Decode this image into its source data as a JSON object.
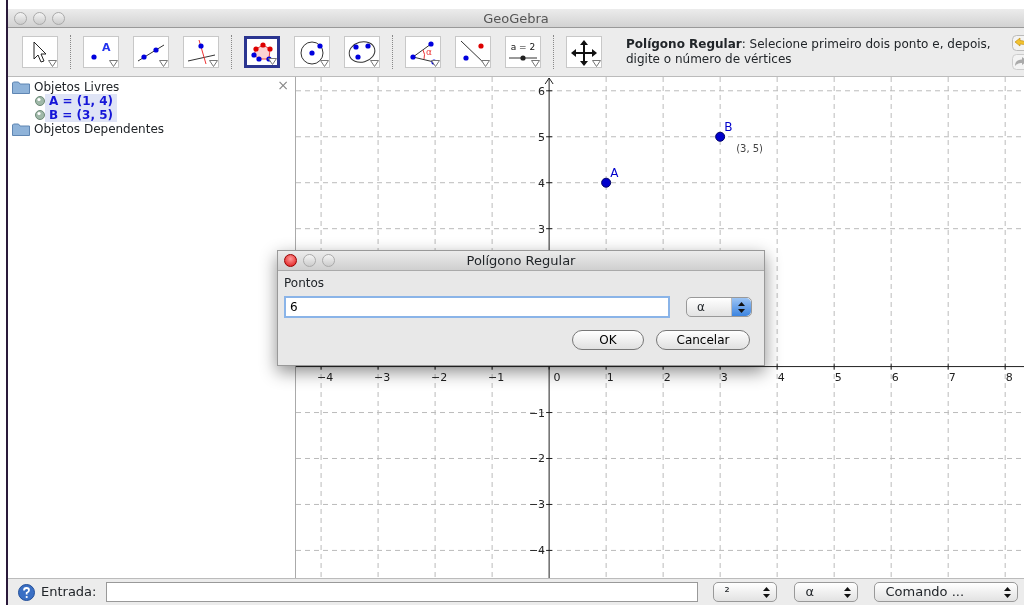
{
  "window": {
    "title": "GeoGebra"
  },
  "toolbar": {
    "groups": [
      [
        {
          "kind": "move",
          "selected": false
        }
      ],
      [
        {
          "kind": "point",
          "label": "A",
          "selected": false
        },
        {
          "kind": "line",
          "selected": false
        },
        {
          "kind": "perpendicular",
          "selected": false
        }
      ],
      [
        {
          "kind": "polygon",
          "selected": true
        },
        {
          "kind": "circle",
          "selected": false
        },
        {
          "kind": "conic",
          "selected": false
        }
      ],
      [
        {
          "kind": "angle",
          "label": "α",
          "selected": false
        },
        {
          "kind": "reflect",
          "selected": false
        },
        {
          "kind": "slider",
          "label": "a = 2",
          "selected": false
        }
      ],
      [
        {
          "kind": "move_view",
          "selected": false
        }
      ]
    ],
    "help": "**Polígono Regular**: Selecione primeiro dois ponto e, depois, digite o número de vértices"
  },
  "algebra_view": {
    "close": "×",
    "folders": [
      {
        "label": "Objetos Livres",
        "children": [
          {
            "label": "A = (1, 4)",
            "selected": true
          },
          {
            "label": "B = (3, 5)",
            "selected": true
          }
        ]
      },
      {
        "label": "Objetos Dependentes"
      }
    ]
  },
  "graphics_view": {
    "chart_data": {
      "type": "scatter",
      "x": [
        1,
        3
      ],
      "series": [
        {
          "name": "A",
          "color": "#0000cc",
          "values": [
            4,
            null
          ]
        },
        {
          "name": "B",
          "color": "#0000cc",
          "values": [
            null,
            5
          ]
        }
      ],
      "grid": true,
      "xlim": [
        -4.44,
        8.33
      ],
      "ylim": [
        -4.6,
        6.3
      ],
      "xticks": [
        -4,
        -3,
        -2,
        -1,
        0,
        1,
        2,
        3,
        4,
        5,
        6,
        7,
        8
      ],
      "yticks": [
        -4,
        -3,
        -2,
        -1,
        3,
        4,
        5,
        6
      ],
      "annotations": [
        "(3, 5)"
      ]
    }
  },
  "dialog": {
    "title": "Polígono Regular",
    "field_label": "Pontos",
    "value": "6",
    "symbol_menu": "α",
    "buttons": [
      "OK",
      "Cancelar"
    ]
  },
  "input_bar": {
    "label": "Entrada:",
    "menus": [
      "²",
      "α",
      "Comando ..."
    ]
  }
}
